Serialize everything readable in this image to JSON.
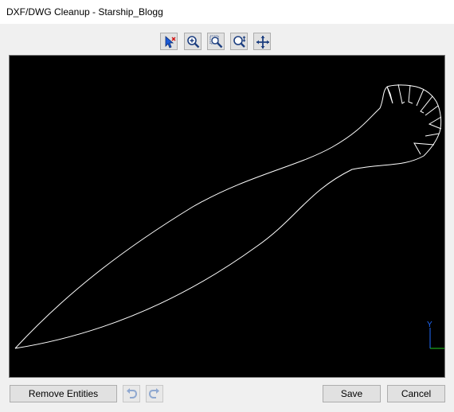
{
  "window": {
    "title": "DXF/DWG Cleanup - Starship_Blogg"
  },
  "toolbar": {
    "tools": [
      {
        "icon": "select-pointer-icon",
        "state": "active"
      },
      {
        "icon": "zoom-in-icon"
      },
      {
        "icon": "zoom-window-icon"
      },
      {
        "icon": "zoom-extents-icon"
      },
      {
        "icon": "pan-icon"
      }
    ]
  },
  "canvas": {
    "background": "#000000",
    "drawing_color": "#ffffff",
    "axis_y_color": "#1f6bff",
    "axis_x_color": "#22cc22",
    "axis_y_label": "Y"
  },
  "footer": {
    "remove_entities_label": "Remove Entities",
    "undo_icon": "undo-icon",
    "redo_icon": "redo-icon",
    "save_label": "Save",
    "cancel_label": "Cancel"
  }
}
